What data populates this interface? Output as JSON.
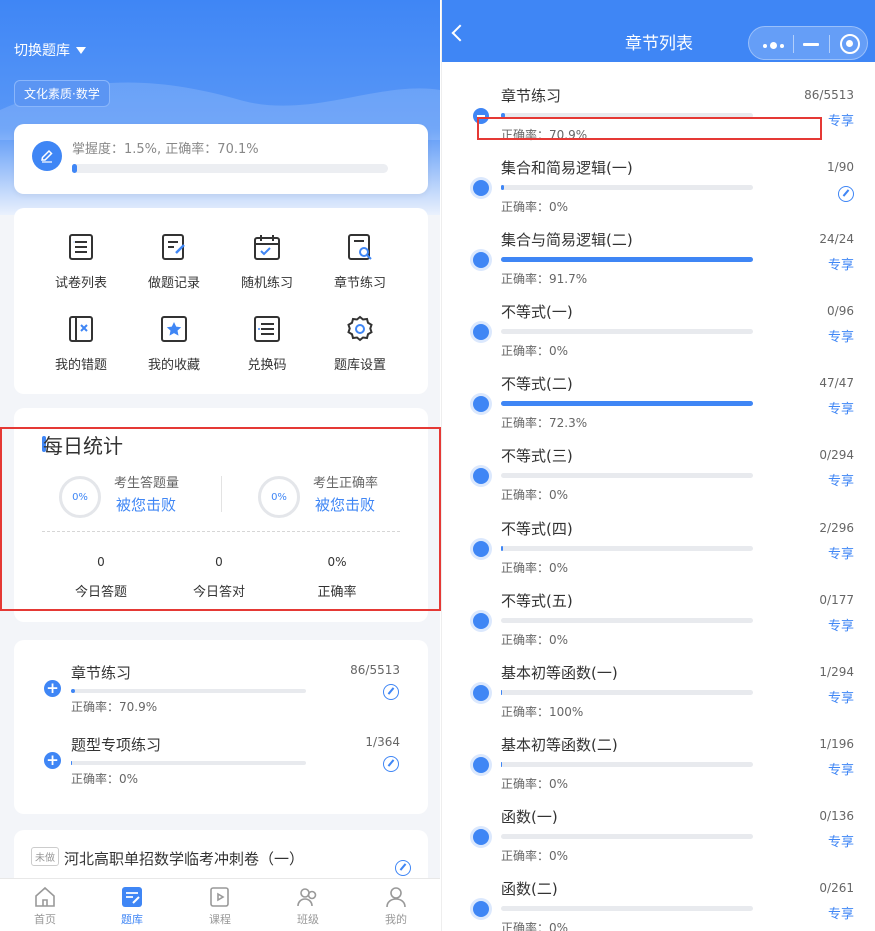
{
  "left": {
    "switch_label": "切换题库",
    "subject_tag": "文化素质·数学",
    "mastery": {
      "text": "掌握度：1.5%, 正确率：70.1%",
      "progress": 0.015
    },
    "grid": [
      {
        "label": "试卷列表",
        "icon": "list-icon"
      },
      {
        "label": "做题记录",
        "icon": "record-icon"
      },
      {
        "label": "随机练习",
        "icon": "calendar-icon"
      },
      {
        "label": "章节练习",
        "icon": "chapter-search-icon"
      },
      {
        "label": "我的错题",
        "icon": "wrong-book-icon"
      },
      {
        "label": "我的收藏",
        "icon": "star-icon"
      },
      {
        "label": "兑换码",
        "icon": "code-list-icon"
      },
      {
        "label": "题库设置",
        "icon": "gear-icon"
      }
    ],
    "stats": {
      "title": "每日统计",
      "ring1": {
        "pct": "0%",
        "label": "考生答题量",
        "link": "被您击败"
      },
      "ring2": {
        "pct": "0%",
        "label": "考生正确率",
        "link": "被您击败"
      },
      "items": [
        {
          "value": "0",
          "label": "今日答题"
        },
        {
          "value": "0",
          "label": "今日答对"
        },
        {
          "value": "0%",
          "label": "正确率"
        }
      ]
    },
    "chapters": [
      {
        "title": "章节练习",
        "count": "86/5513",
        "acc": "正确率：70.9%",
        "progress": 0.016
      },
      {
        "title": "题型专项练习",
        "count": "1/364",
        "acc": "正确率：0%",
        "progress": 0.003
      }
    ],
    "paper": {
      "tag": "未做",
      "title": "河北高职单招数学临考冲刺卷（一）"
    },
    "tabs": [
      {
        "label": "首页",
        "icon": "home-icon"
      },
      {
        "label": "题库",
        "icon": "question-bank-icon"
      },
      {
        "label": "课程",
        "icon": "course-icon"
      },
      {
        "label": "班级",
        "icon": "class-icon"
      },
      {
        "label": "我的",
        "icon": "user-icon"
      }
    ]
  },
  "right": {
    "title": "章节列表",
    "rows": [
      {
        "title": "章节练习",
        "count": "86/5513",
        "acc": "正确率：70.9%",
        "badge": "专享",
        "progress": 0.016
      },
      {
        "title": "集合和简易逻辑(一)",
        "count": "1/90",
        "acc": "正确率：0%",
        "badge": "",
        "progress": 0.011
      },
      {
        "title": "集合与简易逻辑(二)",
        "count": "24/24",
        "acc": "正确率：91.7%",
        "badge": "专享",
        "progress": 1.0
      },
      {
        "title": "不等式(一)",
        "count": "0/96",
        "acc": "正确率：0%",
        "badge": "专享",
        "progress": 0
      },
      {
        "title": "不等式(二)",
        "count": "47/47",
        "acc": "正确率：72.3%",
        "badge": "专享",
        "progress": 1.0
      },
      {
        "title": "不等式(三)",
        "count": "0/294",
        "acc": "正确率：0%",
        "badge": "专享",
        "progress": 0
      },
      {
        "title": "不等式(四)",
        "count": "2/296",
        "acc": "正确率：0%",
        "badge": "专享",
        "progress": 0.007
      },
      {
        "title": "不等式(五)",
        "count": "0/177",
        "acc": "正确率：0%",
        "badge": "专享",
        "progress": 0
      },
      {
        "title": "基本初等函数(一)",
        "count": "1/294",
        "acc": "正确率：100%",
        "badge": "专享",
        "progress": 0.003
      },
      {
        "title": "基本初等函数(二)",
        "count": "1/196",
        "acc": "正确率：0%",
        "badge": "专享",
        "progress": 0.005
      },
      {
        "title": "函数(一)",
        "count": "0/136",
        "acc": "正确率：0%",
        "badge": "专享",
        "progress": 0
      },
      {
        "title": "函数(二)",
        "count": "0/261",
        "acc": "正确率：0%",
        "badge": "专享",
        "progress": 0
      }
    ]
  },
  "colors": {
    "primary": "#3f86f5",
    "highlight": "#e53935"
  }
}
